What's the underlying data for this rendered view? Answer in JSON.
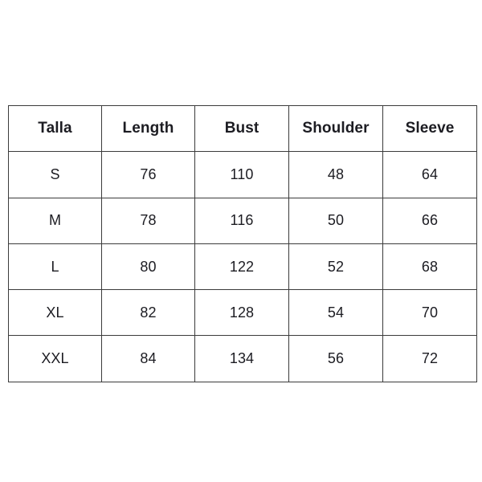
{
  "document": {
    "type": "size-chart-table",
    "background_color": "#ffffff",
    "border_color": "#3b3b3b",
    "text_color": "#1c1c22"
  },
  "table": {
    "headers": [
      {
        "key": "size",
        "label": "Talla"
      },
      {
        "key": "length",
        "label": "Length"
      },
      {
        "key": "bust",
        "label": "Bust"
      },
      {
        "key": "shoulder",
        "label": "Shoulder"
      },
      {
        "key": "sleeve",
        "label": "Sleeve"
      }
    ],
    "rows": [
      {
        "size": "S",
        "length": "76",
        "bust": "110",
        "shoulder": "48",
        "sleeve": "64"
      },
      {
        "size": "M",
        "length": "78",
        "bust": "116",
        "shoulder": "50",
        "sleeve": "66"
      },
      {
        "size": "L",
        "length": "80",
        "bust": "122",
        "shoulder": "52",
        "sleeve": "68"
      },
      {
        "size": "XL",
        "length": "82",
        "bust": "128",
        "shoulder": "54",
        "sleeve": "70"
      },
      {
        "size": "XXL",
        "length": "84",
        "bust": "134",
        "shoulder": "56",
        "sleeve": "72"
      }
    ]
  },
  "chart_data": {
    "type": "table",
    "title": "",
    "columns": [
      "Talla",
      "Length",
      "Bust",
      "Shoulder",
      "Sleeve"
    ],
    "rows": [
      [
        "S",
        76,
        110,
        48,
        64
      ],
      [
        "M",
        78,
        116,
        50,
        66
      ],
      [
        "L",
        80,
        122,
        52,
        68
      ],
      [
        "XL",
        82,
        128,
        54,
        70
      ],
      [
        "XXL",
        84,
        134,
        56,
        72
      ]
    ]
  }
}
